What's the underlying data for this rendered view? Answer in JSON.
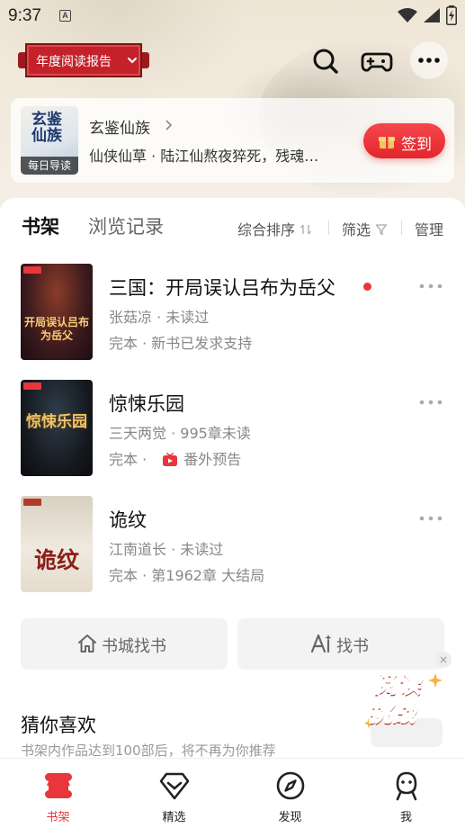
{
  "status_bar": {
    "time": "9:37",
    "notif_icon": "A"
  },
  "header": {
    "report_label": "年度阅读报告",
    "icons": [
      "search-icon",
      "gamepad-icon",
      "more-icon"
    ]
  },
  "daily_guide": {
    "cover_text": "玄鉴仙族",
    "cover_tag": "每日导读",
    "title": "玄鉴仙族",
    "description": "仙侠仙草 · 陆江仙熬夜猝死，残魂…",
    "signin_label": "签到"
  },
  "shelf": {
    "tabs": [
      {
        "label": "书架",
        "active": true
      },
      {
        "label": "浏览记录",
        "active": false
      }
    ],
    "sort_label": "综合排序",
    "filter_label": "筛选",
    "manage_label": "管理",
    "books": [
      {
        "title": "三国：开局误认吕布为岳父",
        "author_line": "张菇凉 · 未读过",
        "status_line": "完本 · 新书已发求支持",
        "cover_text": "开局误认吕布为岳父",
        "unread_dot": true
      },
      {
        "title": "惊悚乐园",
        "author_line": "三天两觉 · 995章未读",
        "status_prefix": "完本 · ",
        "status_line": "番外预告",
        "cover_text": "惊悚乐园",
        "unread_dot": false
      },
      {
        "title": "诡纹",
        "author_line": "江南道长 · 未读过",
        "status_line": "完本 · 第1962章 大结局",
        "cover_text": "诡纹",
        "unread_dot": false
      }
    ]
  },
  "find_buttons": {
    "bookstore": "书城找书",
    "ai_find": "找书"
  },
  "challenge": {
    "line1": "阅读",
    "line2": "挑战",
    "close": "×"
  },
  "guess": {
    "title": "猜你喜欢",
    "subtitle": "书架内作品达到100部后，将不再为你推荐"
  },
  "bottom_nav": [
    {
      "label": "书架",
      "icon": "bookshelf-icon",
      "active": true
    },
    {
      "label": "精选",
      "icon": "diamond-icon",
      "active": false
    },
    {
      "label": "发现",
      "icon": "compass-icon",
      "active": false
    },
    {
      "label": "我",
      "icon": "profile-icon",
      "active": false
    }
  ],
  "colors": {
    "accent": "#e8363c",
    "report_red": "#c4222a",
    "muted": "#888888"
  }
}
